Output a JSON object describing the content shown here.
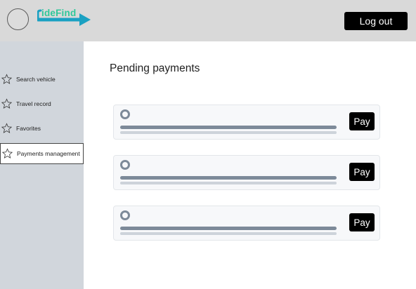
{
  "header": {
    "logo_text": "ideFind",
    "logout_label": "Log out"
  },
  "sidebar": {
    "items": [
      {
        "label": "Search vehicle",
        "icon": "star-icon",
        "active": false
      },
      {
        "label": "Travel record",
        "icon": "star-icon",
        "active": false
      },
      {
        "label": "Favorites",
        "icon": "star-icon",
        "active": false
      },
      {
        "label": "Payments management",
        "icon": "star-icon",
        "active": true
      }
    ]
  },
  "main": {
    "title": "Pending payments",
    "payments": [
      {
        "pay_label": "Pay"
      },
      {
        "pay_label": "Pay"
      },
      {
        "pay_label": "Pay"
      }
    ]
  },
  "colors": {
    "header_bg": "#d9d9d9",
    "sidebar_bg": "#d1d6dc",
    "logo_green": "#2fc89a",
    "logo_blue": "#1ba1c2",
    "button_bg": "#000000",
    "bar_dark": "#7d8a99",
    "bar_light": "#cdd3da"
  }
}
